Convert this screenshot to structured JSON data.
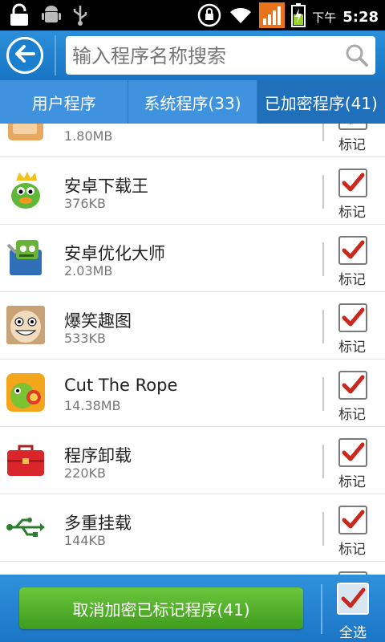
{
  "status_bar": {
    "ampm": "下午",
    "time": "5:28"
  },
  "search": {
    "placeholder": "输入程序名称搜索"
  },
  "tabs": [
    {
      "label": "用户程序",
      "active": false
    },
    {
      "label": "系统程序(33)",
      "active": false
    },
    {
      "label": "已加密程序(41)",
      "active": true
    }
  ],
  "mark_label": "标记",
  "apps": [
    {
      "name": "",
      "size": "1.80MB",
      "checked": true,
      "icon": "partial-app-icon"
    },
    {
      "name": "安卓下载王",
      "size": "376KB",
      "checked": true,
      "icon": "green-bird-king-icon"
    },
    {
      "name": "安卓优化大师",
      "size": "2.03MB",
      "checked": true,
      "icon": "optimizer-robot-icon"
    },
    {
      "name": "爆笑趣图",
      "size": "533KB",
      "checked": true,
      "icon": "funny-face-icon"
    },
    {
      "name": "Cut The Rope",
      "size": "14.38MB",
      "checked": true,
      "icon": "cut-the-rope-icon"
    },
    {
      "name": "程序卸载",
      "size": "220KB",
      "checked": true,
      "icon": "red-toolbox-icon"
    },
    {
      "name": "多重挂载",
      "size": "144KB",
      "checked": true,
      "icon": "usb-icon"
    }
  ],
  "bottom": {
    "action_label": "取消加密已标记程序(41)",
    "select_all_label": "全选",
    "select_all_checked": true
  },
  "colors": {
    "accent": "#1f6fbb",
    "check": "#c8281e",
    "button_green": "#4fae28"
  }
}
